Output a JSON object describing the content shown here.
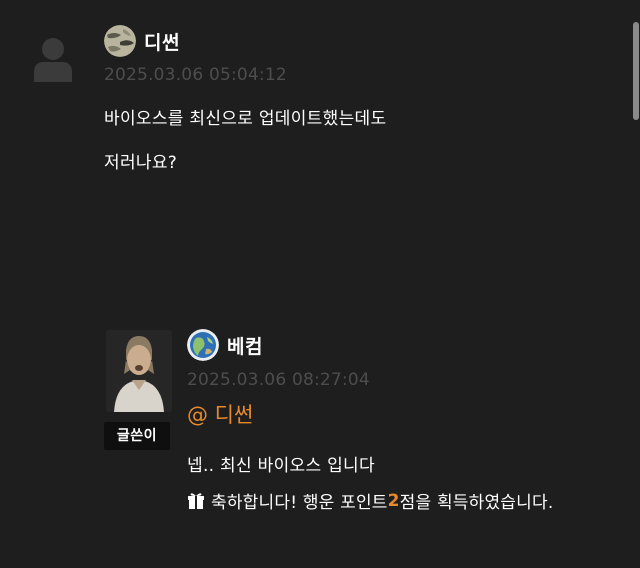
{
  "comments": [
    {
      "author": "디썬",
      "timestamp": "2025.03.06 05:04:12",
      "body_lines": [
        "바이오스를 최신으로 업데이트했는데도",
        "저러나요?"
      ],
      "avatar_icon": "default-user-icon",
      "level_icon": "camo-level-icon"
    },
    {
      "author": "베컴",
      "timestamp": "2025.03.06 08:27:04",
      "author_badge": "글쓴이",
      "mention": "@ 디썬",
      "body_lines": [
        "넵.. 최신 바이오스 입니다"
      ],
      "lucky": {
        "prefix": "축하합니다! 행운 포인트 ",
        "points": "2",
        "suffix": "점을 획득하였습니다.",
        "icon": "gift-icon"
      },
      "avatar_icon": "user-photo-avatar",
      "level_icon": "globe-level-icon"
    }
  ],
  "colors": {
    "background": "#1e1e1e",
    "timestamp": "#4d4d4d",
    "accent": "#e8892b",
    "badge_bg": "#0f0f0f",
    "text": "#ffffff"
  }
}
